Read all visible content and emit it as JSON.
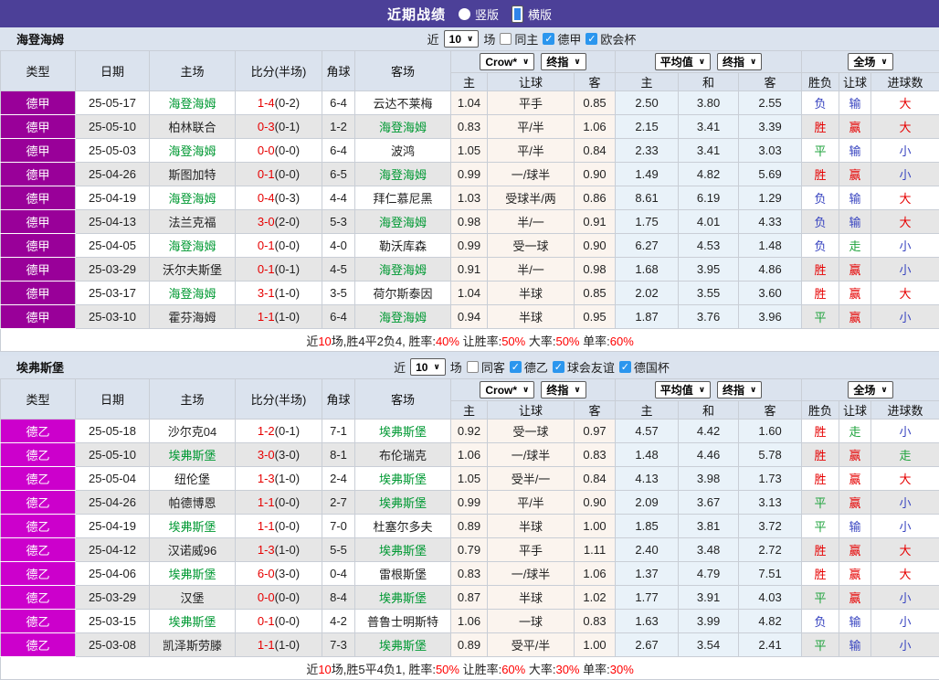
{
  "titlebar": {
    "title": "近期战绩",
    "radios": [
      {
        "label": "竖版",
        "selected": false
      },
      {
        "label": "横版",
        "selected": true
      }
    ]
  },
  "columns": {
    "main": [
      "类型",
      "日期",
      "主场",
      "比分(半场)",
      "角球",
      "客场"
    ],
    "sub": [
      "主",
      "让球",
      "客",
      "主",
      "和",
      "客",
      "胜负",
      "让球",
      "进球数"
    ],
    "widths": [
      82,
      81,
      94,
      95,
      36,
      105,
      40,
      95,
      45,
      69,
      66,
      69,
      41,
      35,
      75
    ]
  },
  "dropdowns": {
    "crow": "Crow*",
    "final1": "终指",
    "avg": "平均值",
    "final2": "终指",
    "scope": "全场"
  },
  "colors": {
    "titlebar_bg": "#4c4098",
    "league1_bg": "#990099",
    "league2_bg": "#cc00cc",
    "focal_team": "#009933",
    "result_red": "#e60000",
    "result_green": "#1fa33c",
    "result_blue": "#3844c0",
    "odds_col_bg": "#fbf4ee",
    "avg_col_bg": "#e9f2f9"
  },
  "sections": [
    {
      "team": "海登海姆",
      "league_color": "#990099",
      "filter": {
        "near": "近",
        "count": "10",
        "unit": "场",
        "checkboxes": [
          {
            "label": "同主",
            "checked": false
          },
          {
            "label": "德甲",
            "checked": true
          },
          {
            "label": "欧会杯",
            "checked": true
          }
        ]
      },
      "rows": [
        {
          "type": "德甲",
          "date": "25-05-17",
          "home": "海登海姆",
          "home_focal": true,
          "score": "1-4",
          "half": "(0-2)",
          "corner": "6-4",
          "away": "云达不莱梅",
          "away_focal": false,
          "odds": [
            "1.04",
            "平手",
            "0.85"
          ],
          "avg": [
            "2.50",
            "3.80",
            "2.55"
          ],
          "results": [
            "负",
            "输",
            "大"
          ]
        },
        {
          "type": "德甲",
          "date": "25-05-10",
          "home": "柏林联合",
          "home_focal": false,
          "score": "0-3",
          "half": "(0-1)",
          "corner": "1-2",
          "away": "海登海姆",
          "away_focal": true,
          "odds": [
            "0.83",
            "平/半",
            "1.06"
          ],
          "avg": [
            "2.15",
            "3.41",
            "3.39"
          ],
          "results": [
            "胜",
            "赢",
            "大"
          ]
        },
        {
          "type": "德甲",
          "date": "25-05-03",
          "home": "海登海姆",
          "home_focal": true,
          "score": "0-0",
          "half": "(0-0)",
          "corner": "6-4",
          "away": "波鸿",
          "away_focal": false,
          "odds": [
            "1.05",
            "平/半",
            "0.84"
          ],
          "avg": [
            "2.33",
            "3.41",
            "3.03"
          ],
          "results": [
            "平",
            "输",
            "小"
          ]
        },
        {
          "type": "德甲",
          "date": "25-04-26",
          "home": "斯图加特",
          "home_focal": false,
          "score": "0-1",
          "half": "(0-0)",
          "corner": "6-5",
          "away": "海登海姆",
          "away_focal": true,
          "odds": [
            "0.99",
            "一/球半",
            "0.90"
          ],
          "avg": [
            "1.49",
            "4.82",
            "5.69"
          ],
          "results": [
            "胜",
            "赢",
            "小"
          ]
        },
        {
          "type": "德甲",
          "date": "25-04-19",
          "home": "海登海姆",
          "home_focal": true,
          "score": "0-4",
          "half": "(0-3)",
          "corner": "4-4",
          "away": "拜仁慕尼黑",
          "away_focal": false,
          "odds": [
            "1.03",
            "受球半/两",
            "0.86"
          ],
          "avg": [
            "8.61",
            "6.19",
            "1.29"
          ],
          "results": [
            "负",
            "输",
            "大"
          ]
        },
        {
          "type": "德甲",
          "date": "25-04-13",
          "home": "法兰克福",
          "home_focal": false,
          "score": "3-0",
          "half": "(2-0)",
          "corner": "5-3",
          "away": "海登海姆",
          "away_focal": true,
          "odds": [
            "0.98",
            "半/一",
            "0.91"
          ],
          "avg": [
            "1.75",
            "4.01",
            "4.33"
          ],
          "results": [
            "负",
            "输",
            "大"
          ]
        },
        {
          "type": "德甲",
          "date": "25-04-05",
          "home": "海登海姆",
          "home_focal": true,
          "score": "0-1",
          "half": "(0-0)",
          "corner": "4-0",
          "away": "勒沃库森",
          "away_focal": false,
          "odds": [
            "0.99",
            "受一球",
            "0.90"
          ],
          "avg": [
            "6.27",
            "4.53",
            "1.48"
          ],
          "results": [
            "负",
            "走",
            "小"
          ]
        },
        {
          "type": "德甲",
          "date": "25-03-29",
          "home": "沃尔夫斯堡",
          "home_focal": false,
          "score": "0-1",
          "half": "(0-1)",
          "corner": "4-5",
          "away": "海登海姆",
          "away_focal": true,
          "odds": [
            "0.91",
            "半/一",
            "0.98"
          ],
          "avg": [
            "1.68",
            "3.95",
            "4.86"
          ],
          "results": [
            "胜",
            "赢",
            "小"
          ]
        },
        {
          "type": "德甲",
          "date": "25-03-17",
          "home": "海登海姆",
          "home_focal": true,
          "score": "3-1",
          "half": "(1-0)",
          "corner": "3-5",
          "away": "荷尔斯泰因",
          "away_focal": false,
          "odds": [
            "1.04",
            "半球",
            "0.85"
          ],
          "avg": [
            "2.02",
            "3.55",
            "3.60"
          ],
          "results": [
            "胜",
            "赢",
            "大"
          ]
        },
        {
          "type": "德甲",
          "date": "25-03-10",
          "home": "霍芬海姆",
          "home_focal": false,
          "score": "1-1",
          "half": "(1-0)",
          "corner": "6-4",
          "away": "海登海姆",
          "away_focal": true,
          "odds": [
            "0.94",
            "半球",
            "0.95"
          ],
          "avg": [
            "1.87",
            "3.76",
            "3.96"
          ],
          "results": [
            "平",
            "赢",
            "小"
          ]
        }
      ],
      "summary": [
        {
          "t": "近",
          "red": false
        },
        {
          "t": "10",
          "red": true
        },
        {
          "t": "场,胜4平2负4, 胜率:",
          "red": false
        },
        {
          "t": "40%",
          "red": true
        },
        {
          "t": " 让胜率:",
          "red": false
        },
        {
          "t": "50%",
          "red": true
        },
        {
          "t": " 大率:",
          "red": false
        },
        {
          "t": "50%",
          "red": true
        },
        {
          "t": " 单率:",
          "red": false
        },
        {
          "t": "60%",
          "red": true
        }
      ]
    },
    {
      "team": "埃弗斯堡",
      "league_color": "#cc00cc",
      "filter": {
        "near": "近",
        "count": "10",
        "unit": "场",
        "checkboxes": [
          {
            "label": "同客",
            "checked": false
          },
          {
            "label": "德乙",
            "checked": true
          },
          {
            "label": "球会友谊",
            "checked": true
          },
          {
            "label": "德国杯",
            "checked": true
          }
        ]
      },
      "rows": [
        {
          "type": "德乙",
          "date": "25-05-18",
          "home": "沙尔克04",
          "home_focal": false,
          "score": "1-2",
          "half": "(0-1)",
          "corner": "7-1",
          "away": "埃弗斯堡",
          "away_focal": true,
          "odds": [
            "0.92",
            "受一球",
            "0.97"
          ],
          "avg": [
            "4.57",
            "4.42",
            "1.60"
          ],
          "results": [
            "胜",
            "走",
            "小"
          ]
        },
        {
          "type": "德乙",
          "date": "25-05-10",
          "home": "埃弗斯堡",
          "home_focal": true,
          "score": "3-0",
          "half": "(3-0)",
          "corner": "8-1",
          "away": "布伦瑞克",
          "away_focal": false,
          "odds": [
            "1.06",
            "一/球半",
            "0.83"
          ],
          "avg": [
            "1.48",
            "4.46",
            "5.78"
          ],
          "results": [
            "胜",
            "赢",
            "走"
          ]
        },
        {
          "type": "德乙",
          "date": "25-05-04",
          "home": "纽伦堡",
          "home_focal": false,
          "score": "1-3",
          "half": "(1-0)",
          "corner": "2-4",
          "away": "埃弗斯堡",
          "away_focal": true,
          "odds": [
            "1.05",
            "受半/一",
            "0.84"
          ],
          "avg": [
            "4.13",
            "3.98",
            "1.73"
          ],
          "results": [
            "胜",
            "赢",
            "大"
          ]
        },
        {
          "type": "德乙",
          "date": "25-04-26",
          "home": "帕德博恩",
          "home_focal": false,
          "score": "1-1",
          "half": "(0-0)",
          "corner": "2-7",
          "away": "埃弗斯堡",
          "away_focal": true,
          "odds": [
            "0.99",
            "平/半",
            "0.90"
          ],
          "avg": [
            "2.09",
            "3.67",
            "3.13"
          ],
          "results": [
            "平",
            "赢",
            "小"
          ]
        },
        {
          "type": "德乙",
          "date": "25-04-19",
          "home": "埃弗斯堡",
          "home_focal": true,
          "score": "1-1",
          "half": "(0-0)",
          "corner": "7-0",
          "away": "杜塞尔多夫",
          "away_focal": false,
          "odds": [
            "0.89",
            "半球",
            "1.00"
          ],
          "avg": [
            "1.85",
            "3.81",
            "3.72"
          ],
          "results": [
            "平",
            "输",
            "小"
          ]
        },
        {
          "type": "德乙",
          "date": "25-04-12",
          "home": "汉诺威96",
          "home_focal": false,
          "score": "1-3",
          "half": "(1-0)",
          "corner": "5-5",
          "away": "埃弗斯堡",
          "away_focal": true,
          "odds": [
            "0.79",
            "平手",
            "1.11"
          ],
          "avg": [
            "2.40",
            "3.48",
            "2.72"
          ],
          "results": [
            "胜",
            "赢",
            "大"
          ]
        },
        {
          "type": "德乙",
          "date": "25-04-06",
          "home": "埃弗斯堡",
          "home_focal": true,
          "score": "6-0",
          "half": "(3-0)",
          "corner": "0-4",
          "away": "雷根斯堡",
          "away_focal": false,
          "odds": [
            "0.83",
            "一/球半",
            "1.06"
          ],
          "avg": [
            "1.37",
            "4.79",
            "7.51"
          ],
          "results": [
            "胜",
            "赢",
            "大"
          ]
        },
        {
          "type": "德乙",
          "date": "25-03-29",
          "home": "汉堡",
          "home_focal": false,
          "score": "0-0",
          "half": "(0-0)",
          "corner": "8-4",
          "away": "埃弗斯堡",
          "away_focal": true,
          "odds": [
            "0.87",
            "半球",
            "1.02"
          ],
          "avg": [
            "1.77",
            "3.91",
            "4.03"
          ],
          "results": [
            "平",
            "赢",
            "小"
          ]
        },
        {
          "type": "德乙",
          "date": "25-03-15",
          "home": "埃弗斯堡",
          "home_focal": true,
          "score": "0-1",
          "half": "(0-0)",
          "corner": "4-2",
          "away": "普鲁士明斯特",
          "away_focal": false,
          "odds": [
            "1.06",
            "一球",
            "0.83"
          ],
          "avg": [
            "1.63",
            "3.99",
            "4.82"
          ],
          "results": [
            "负",
            "输",
            "小"
          ]
        },
        {
          "type": "德乙",
          "date": "25-03-08",
          "home": "凯泽斯劳滕",
          "home_focal": false,
          "score": "1-1",
          "half": "(1-0)",
          "corner": "7-3",
          "away": "埃弗斯堡",
          "away_focal": true,
          "odds": [
            "0.89",
            "受平/半",
            "1.00"
          ],
          "avg": [
            "2.67",
            "3.54",
            "2.41"
          ],
          "results": [
            "平",
            "输",
            "小"
          ]
        }
      ],
      "summary": [
        {
          "t": "近",
          "red": false
        },
        {
          "t": "10",
          "red": true
        },
        {
          "t": "场,胜5平4负1, 胜率:",
          "red": false
        },
        {
          "t": "50%",
          "red": true
        },
        {
          "t": " 让胜率:",
          "red": false
        },
        {
          "t": "60%",
          "red": true
        },
        {
          "t": " 大率:",
          "red": false
        },
        {
          "t": "30%",
          "red": true
        },
        {
          "t": " 单率:",
          "red": false
        },
        {
          "t": "30%",
          "red": true
        }
      ]
    }
  ]
}
